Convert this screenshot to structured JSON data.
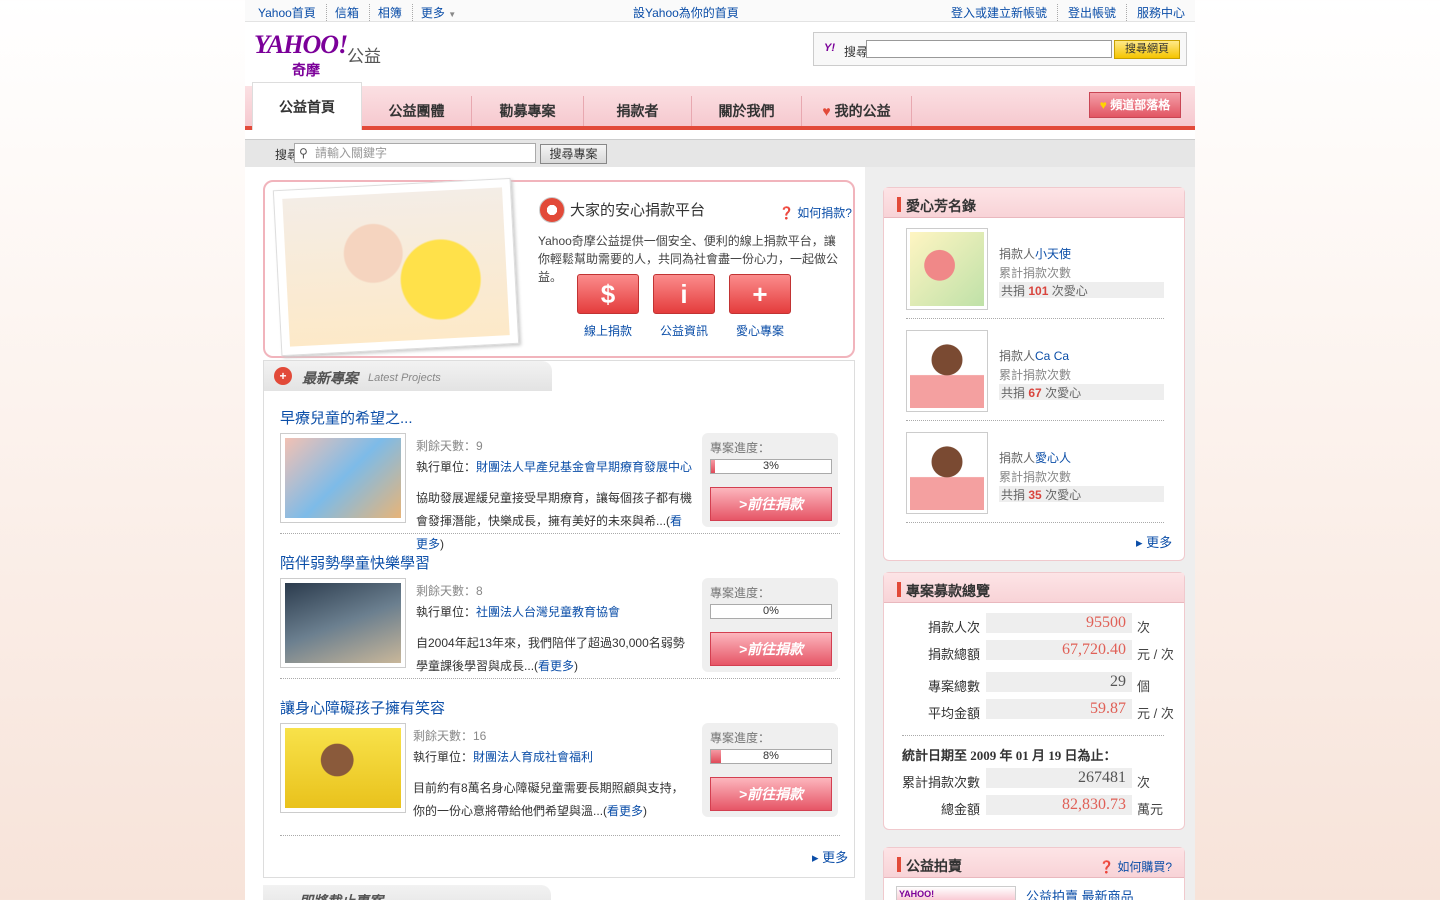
{
  "util": {
    "left": [
      "Yahoo首頁",
      "信箱",
      "相簿",
      "更多"
    ],
    "center": "設Yahoo為你的首頁",
    "right": [
      "登入或建立新帳號",
      "登出帳號",
      "服務中心"
    ]
  },
  "header": {
    "logo": "YAHOO!",
    "logo_sub": "奇摩",
    "section": "公益",
    "search_label": "搜尋",
    "search_btn": "搜尋網頁"
  },
  "nav": {
    "tabs": [
      "公益首頁",
      "公益團體",
      "勸募專案",
      "捐款者",
      "關於我們",
      "我的公益"
    ],
    "blog": "頻道部落格"
  },
  "subsearch": {
    "label": "搜尋",
    "placeholder": "請輸入關鍵字",
    "btn": "搜尋專案"
  },
  "hero": {
    "title": "大家的安心捐款平台",
    "help": "如何捐款?",
    "desc": "Yahoo奇摩公益提供一個安全、便利的線上捐款平台，讓你輕鬆幫助需要的人，共同為社會盡一份心力，一起做公益。",
    "buttons": [
      {
        "icon": "$",
        "label": "線上捐款"
      },
      {
        "icon": "i",
        "label": "公益資訊"
      },
      {
        "icon": "+",
        "label": "愛心專案"
      }
    ]
  },
  "latest": {
    "title": "最新專案",
    "title_en": "Latest Projects",
    "more": "更多",
    "projects": [
      {
        "title": "早療兒童的希望之...",
        "days": "剩餘天數：9",
        "org_label": "執行單位：",
        "org": "財團法人早產兒基金會早期療育發展中心",
        "desc": "協助發展遲緩兒童接受早期療育，讓每個孩子都有機會發揮潛能，快樂成長，擁有美好的未來與",
        "desc_tail": "希",
        "readmore": "看更多",
        "progress_label": "專案進度：",
        "progress": "3%",
        "progress_value": 3,
        "donate": ">前往捐款"
      },
      {
        "title": "陪伴弱勢學童快樂學習",
        "days": "剩餘天數：8",
        "org_label": "執行單位：",
        "org": "社團法人台灣兒童教育協會",
        "desc": "自2004年起13年來，我們陪伴了超過30,000名弱勢學童課後學習",
        "desc_tail": "與成長",
        "readmore": "看更多",
        "progress_label": "專案進度：",
        "progress": "0%",
        "progress_value": 0,
        "donate": ">前往捐款"
      },
      {
        "title": "讓身心障礙孩子擁有笑容",
        "days": "剩餘天數：16",
        "org_label": "執行單位：",
        "org": "財團法人育成社會福利",
        "desc": "目前約有8萬名身心障礙兒童需要長期照顧與支持，你的一份心意將帶給他們希望與",
        "desc_tail": "溫",
        "readmore": "看更多",
        "progress_label": "專案進度：",
        "progress": "8%",
        "progress_value": 8,
        "donate": ">前往捐款"
      }
    ]
  },
  "soon": {
    "title": "即將截止專案"
  },
  "donors": {
    "title": "愛心芳名錄",
    "more": "更多",
    "items": [
      {
        "prefix": "捐款人",
        "name": "小天使",
        "l2": "累計捐款次數",
        "l3a": "共捐",
        "count": "101",
        "l3b": "次愛心"
      },
      {
        "prefix": "捐款人",
        "name": "Ca Ca",
        "l2": "累計捐款次數",
        "l3a": "共捐",
        "count": "67",
        "l3b": "次愛心"
      },
      {
        "prefix": "捐款人",
        "name": "愛心人",
        "l2": "累計捐款次數",
        "l3a": "共捐",
        "count": "35",
        "l3b": "次愛心"
      }
    ]
  },
  "stats": {
    "title": "專案募款總覽",
    "rows": [
      {
        "k": "捐款人次",
        "v": "95500",
        "u": "次"
      },
      {
        "k": "捐款總額",
        "v": "67,720.40",
        "u": "元 / 次"
      },
      {
        "k": "專案總數",
        "v": "29",
        "u": "個"
      },
      {
        "k": "平均金額",
        "v": "59.87",
        "u": "元 / 次"
      }
    ],
    "since_label": "統計日期至 2009 年 01 月 19 日為止：",
    "rows2": [
      {
        "k": "累計捐款次數",
        "v": "267481",
        "u": "次"
      },
      {
        "k": "總金額",
        "v": "82,830.73",
        "u": "萬元"
      }
    ]
  },
  "auction": {
    "title": "公益拍賣",
    "help": "如何購買?",
    "link": "公益拍賣 最新商品"
  }
}
